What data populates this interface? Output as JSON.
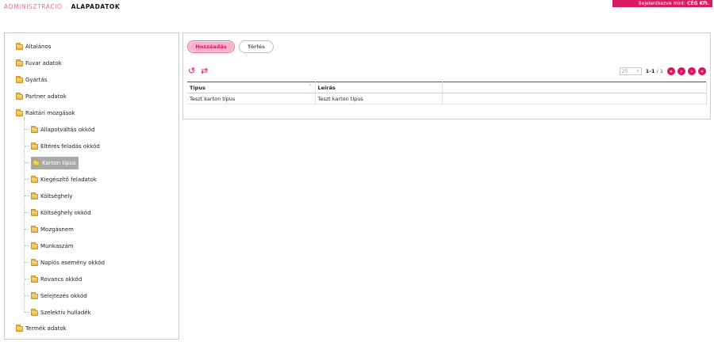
{
  "header": {
    "breadcrumb_parent": "ADMINISZTRÁCIÓ",
    "breadcrumb_separator": "›",
    "breadcrumb_current": "ALAPADATOK",
    "login_label": "Bejelentkezve mint:",
    "login_company": "CÉG Kft."
  },
  "tree": {
    "items": [
      {
        "label": "Általános"
      },
      {
        "label": "Fuvar adatok"
      },
      {
        "label": "Gyártás"
      },
      {
        "label": "Partner adatok"
      },
      {
        "label": "Raktári mozgások"
      },
      {
        "label": "Állapotváltás okkód"
      },
      {
        "label": "Eltérés feladás okkód"
      },
      {
        "label": "Karton típus",
        "selected": true
      },
      {
        "label": "Kiegészítő feladatok"
      },
      {
        "label": "Költséghely"
      },
      {
        "label": "Költséghely okkód"
      },
      {
        "label": "Mozgásnem"
      },
      {
        "label": "Munkaszám"
      },
      {
        "label": "Naplós esemény okkód"
      },
      {
        "label": "Rovancs okkód"
      },
      {
        "label": "Selejtezés okkód"
      },
      {
        "label": "Szelektív hulladék"
      },
      {
        "label": "Termék adatok"
      }
    ]
  },
  "toolbar": {
    "add_label": "Hozzáadás",
    "delete_label": "Törlés"
  },
  "pager": {
    "page_size": "25",
    "range": "1-1",
    "total": "/ 1"
  },
  "icons": {
    "refresh": "refresh-icon",
    "swap": "swap-icon",
    "first": "first-page-icon",
    "prev": "prev-page-icon",
    "next": "next-page-icon",
    "last": "last-page-icon"
  },
  "table": {
    "columns": [
      "Típus",
      "Leírás",
      ""
    ],
    "rows": [
      [
        "Teszt karton típus",
        "Teszt karton típus",
        ""
      ]
    ]
  },
  "colors": {
    "accent": "#e0115f",
    "accent_light": "#f8b2cd",
    "badge": "#d81b60"
  }
}
